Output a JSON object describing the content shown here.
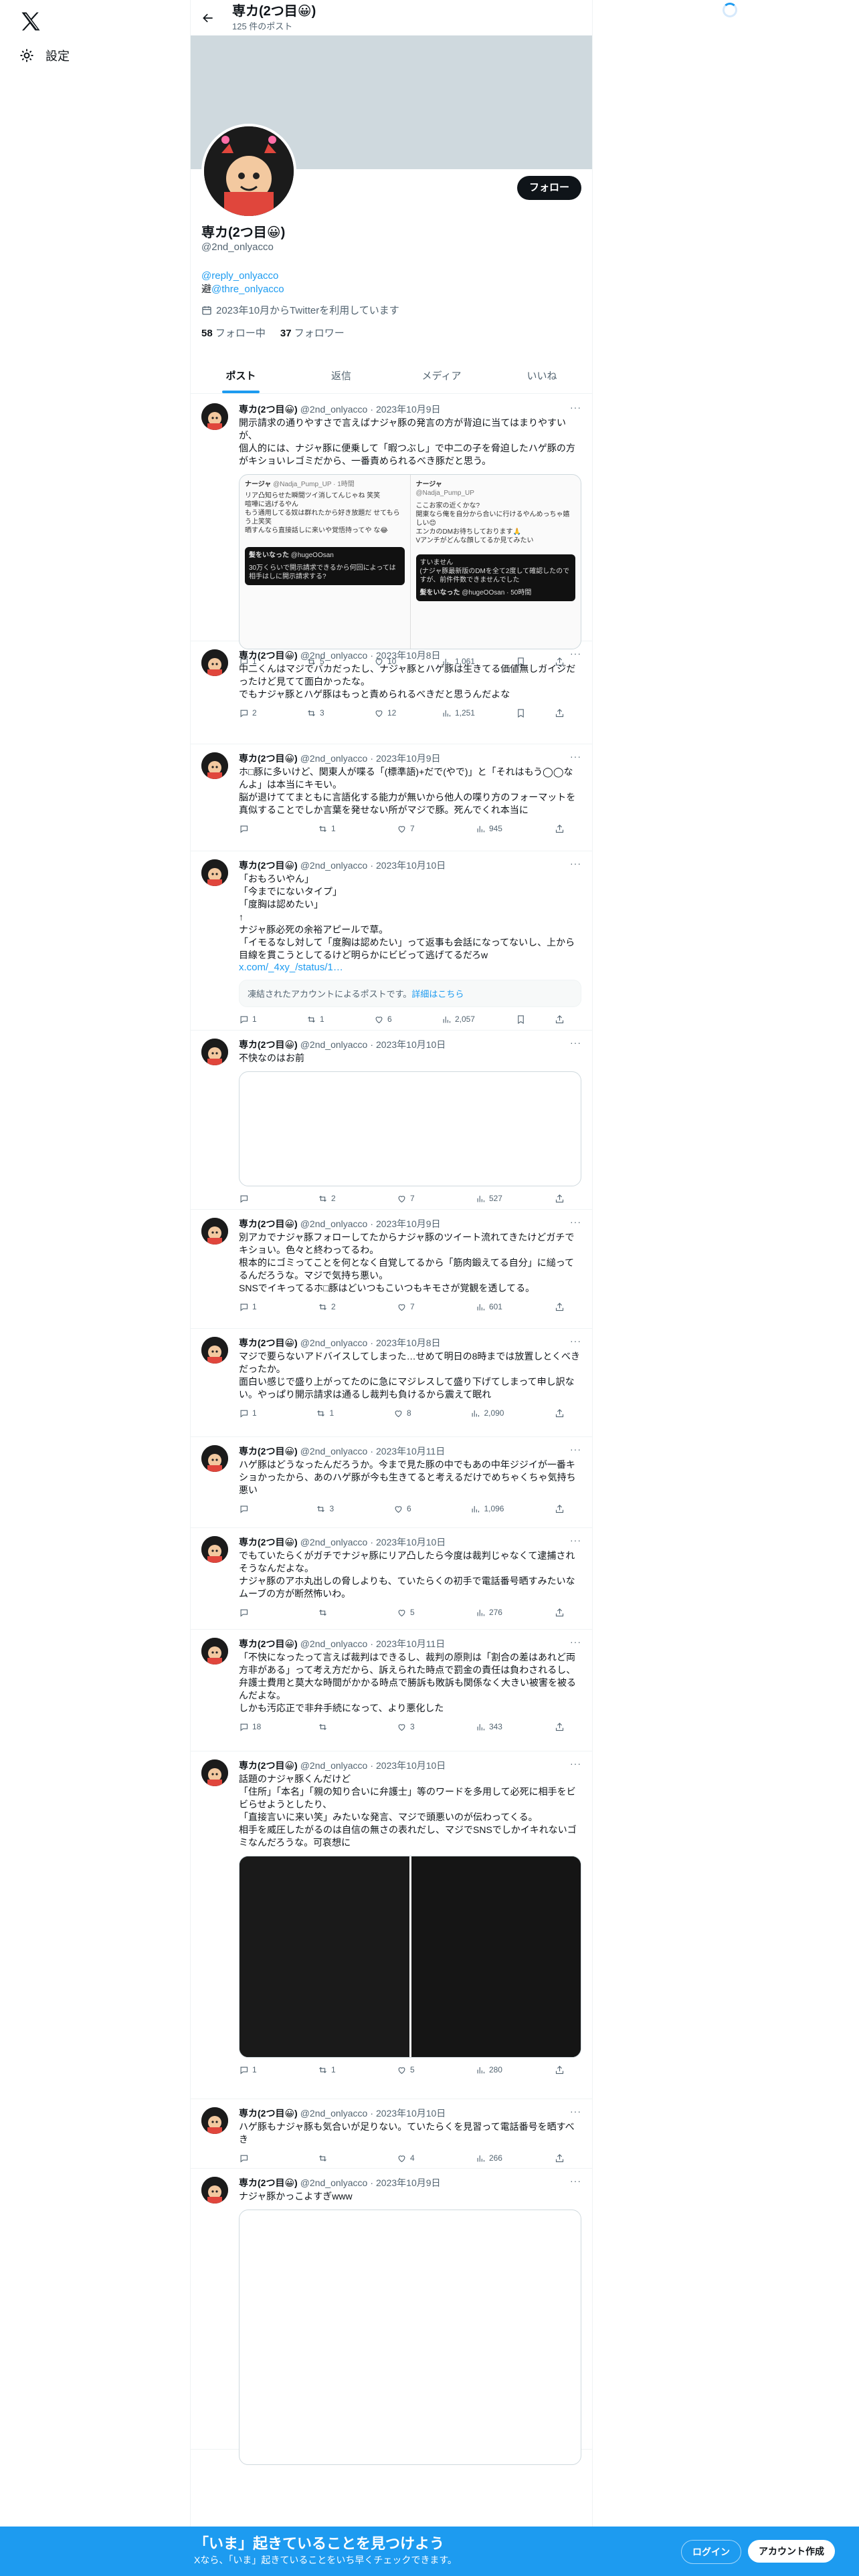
{
  "nav": {
    "settings_label": "設定"
  },
  "header": {
    "name": "専カ(2つ目😀)",
    "post_count": "125 件のポスト"
  },
  "profile": {
    "follow_label": "フォロー",
    "name": "専カ(2つ目😀)",
    "handle": "@2nd_onlyacco",
    "bio_link1": "@reply_onlyacco",
    "bio_prefix2": "避",
    "bio_link2": "@thre_onlyacco",
    "joined": "2023年10月からTwitterを利用しています",
    "following_count": "58",
    "following_label": "フォロー中",
    "followers_count": "37",
    "followers_label": "フォロワー"
  },
  "tabs": [
    "ポスト",
    "返信",
    "メディア",
    "いいね"
  ],
  "tweets": [
    {
      "name": "専カ(2つ目😀)",
      "handle": "@2nd_onlyacco",
      "date": "2023年10月9日",
      "text": "開示請求の通りやすさで言えばナジャ豚の発言の方が背迫に当てはまりやすいが、\n個人的には、ナジャ豚に便乗して「暇つぶし」で中二の子を脅迫したハゲ豚の方がキショいレゴミだから、一番責められるべき豚だと思う。",
      "replies": "1",
      "retweets": "5",
      "likes": "10",
      "views": "1,061"
    },
    {
      "name": "専カ(2つ目😀)",
      "handle": "@2nd_onlyacco",
      "date": "2023年10月8日",
      "text": "中二くんはマジでバカだったし、ナジャ豚とハゲ豚は生きてる価値無しガイジだったけど見てて面白かったな。\nでもナジャ豚とハゲ豚はもっと責められるべきだと思うんだよな",
      "replies": "2",
      "retweets": "3",
      "likes": "12",
      "views": "1,251"
    },
    {
      "name": "専カ(2つ目😀)",
      "handle": "@2nd_onlyacco",
      "date": "2023年10月9日",
      "text": "ホ□豚に多いけど、関東人が喋る「(標準語)+だで(やで)」と「それはもう◯◯なんよ」は本当にキモい。\n脳が退けててまともに言語化する能力が無いから他人の喋り方のフォーマットを真似することでしか言葉を発せない所がマジで豚。死んでくれ本当に",
      "replies": "",
      "retweets": "1",
      "likes": "7",
      "views": "945"
    },
    {
      "name": "専カ(2つ目😀)",
      "handle": "@2nd_onlyacco",
      "date": "2023年10月10日",
      "text": "「おもろいやん」\n「今までにないタイプ」\n「度胸は認めたい」\n↑\nナジャ豚必死の余裕アピールで草。\n「イモるなし対して「度胸は認めたい」って返事も会話になってないし、上から目線を貫こうとしてるけど明らかにビビって逃げてるだろw",
      "link": "x.com/_4xy_/status/1…",
      "withheld": "凍結されたアカウントによるポストです。",
      "withheld_link": "詳細はこちら",
      "replies": "1",
      "retweets": "1",
      "likes": "6",
      "views": "2,057"
    },
    {
      "name": "専カ(2つ目😀)",
      "handle": "@2nd_onlyacco",
      "date": "2023年10月10日",
      "text": "不快なのはお前",
      "replies": "",
      "retweets": "2",
      "likes": "7",
      "views": "527"
    },
    {
      "name": "専カ(2つ目😀)",
      "handle": "@2nd_onlyacco",
      "date": "2023年10月9日",
      "text": "別アカでナジャ豚フォローしてたからナジャ豚のツイート流れてきたけどガチでキショい。色々と終わってるわ。\n根本的にゴミってことを何となく自覚してるから「筋肉鍛えてる自分」に縋ってるんだろうな。マジで気持ち悪い。\nSNSでイキってるホ□豚はどいつもこいつもキモさが覚観を透してる。",
      "replies": "1",
      "retweets": "2",
      "likes": "7",
      "views": "601"
    },
    {
      "name": "専カ(2つ目😀)",
      "handle": "@2nd_onlyacco",
      "date": "2023年10月8日",
      "text": "マジで要らないアドバイスしてしまった…せめて明日の8時までは放置しとくべきだったか。\n面白い感じで盛り上がってたのに急にマジレスして盛り下げてしまって申し訳ない。やっぱり開示請求は通るし裁判も負けるから震えて眠れ",
      "replies": "1",
      "retweets": "1",
      "likes": "8",
      "views": "2,090"
    },
    {
      "name": "専カ(2つ目😀)",
      "handle": "@2nd_onlyacco",
      "date": "2023年10月11日",
      "text": "ハゲ豚はどうなったんだろうか。今まで見た豚の中でもあの中年ジジイが一番キショかったから、あのハゲ豚が今も生きてると考えるだけでめちゃくちゃ気持ち悪い",
      "replies": "",
      "retweets": "3",
      "likes": "6",
      "views": "1,096"
    },
    {
      "name": "専カ(2つ目😀)",
      "handle": "@2nd_onlyacco",
      "date": "2023年10月10日",
      "text": "でもていたらくがガチでナジャ豚にリア凸したら今度は裁判じゃなくて逮捕されそうなんだよな。\nナジャ豚のアホ丸出しの脅しよりも、ていたらくの初手で電話番号晒すみたいなムーブの方が断然怖いわ。",
      "replies": "",
      "retweets": "",
      "likes": "5",
      "views": "276"
    },
    {
      "name": "専カ(2つ目😀)",
      "handle": "@2nd_onlyacco",
      "date": "2023年10月11日",
      "text": "「不快になったって言えば裁判はできるし、裁判の原則は「割合の差はあれど両方非がある」って考え方だから、訴えられた時点で罰金の責任は負わされるし、弁護士費用と莫大な時間がかかる時点で勝訴も敗訴も関係なく大きい被害を被るんだよな。\nしかも汚応正で非弁手続になって、より悪化した",
      "replies": "18",
      "retweets": "",
      "likes": "3",
      "views": "343"
    },
    {
      "name": "専カ(2つ目😀)",
      "handle": "@2nd_onlyacco",
      "date": "2023年10月10日",
      "text": "話題のナジャ豚くんだけど\n「住所」「本名」「親の知り合いに弁護士」等のワードを多用して必死に相手をビビらせようとしたり、\n「直接言いに来い笑」みたいな発言、マジで頭悪いのが伝わってくる。\n相手を威圧したがるのは自信の無さの表れだし、マジでSNSでしかイキれないゴミなんだろうな。可哀想に",
      "replies": "1",
      "retweets": "1",
      "likes": "5",
      "views": "280"
    },
    {
      "name": "専カ(2つ目😀)",
      "handle": "@2nd_onlyacco",
      "date": "2023年10月10日",
      "text": "ハゲ豚もナジャ豚も気合いが足りない。ていたらくを見習って電話番号を晒すべき",
      "replies": "",
      "retweets": "",
      "likes": "4",
      "views": "266"
    },
    {
      "name": "専カ(2つ目😀)",
      "handle": "@2nd_onlyacco",
      "date": "2023年10月9日",
      "text": "ナジャ豚かっこよすぎwww",
      "replies": "",
      "retweets": "",
      "likes": "",
      "views": ""
    }
  ],
  "quote_card": {
    "left_name": "ナージャ",
    "left_handle": "@Nadja_Pump_UP · 1時間",
    "left_text": "リア凸知らせた瞬間ツイ消してんじゃね 笑笑\n喧嘩に逃げるやん\nもう通用してる奴は群れたから好き放題だ せてもらう上笑笑\n晒すんなら直接話しに来いや覚悟持ってや な😂",
    "right_name": "ナージャ",
    "right_handle": "@Nadja_Pump_UP",
    "right_text": "ここお家の近くかな?\n開東なら俺を自分から合いに行けるやんめっちゃ嬉しい😊\nエンカのDMお待ちしております🙏\nVアンチがどんな顔してるか見てみたい",
    "bottom_left_name": "髪をいなった",
    "bottom_left_handle": "@hugeOOsan",
    "bottom_left_text": "30万くらいで開示請求できるから何回によっては相手はしに開示請求する?",
    "bottom_right_text": "すいません\n(ナジャ豚最新版のDMを全て2度して確認したのですが、前件件数できませんでした",
    "bottom_right_name": "髪をいなった",
    "bottom_right_handle": "@hugeOOsan · 50時間"
  },
  "bottom_bar": {
    "title": "「いま」起きていることを見つけよう",
    "subtitle": "Xなら、「いま」起きていることをいち早くチェックできます。",
    "login": "ログイン",
    "signup": "アカウント作成"
  }
}
